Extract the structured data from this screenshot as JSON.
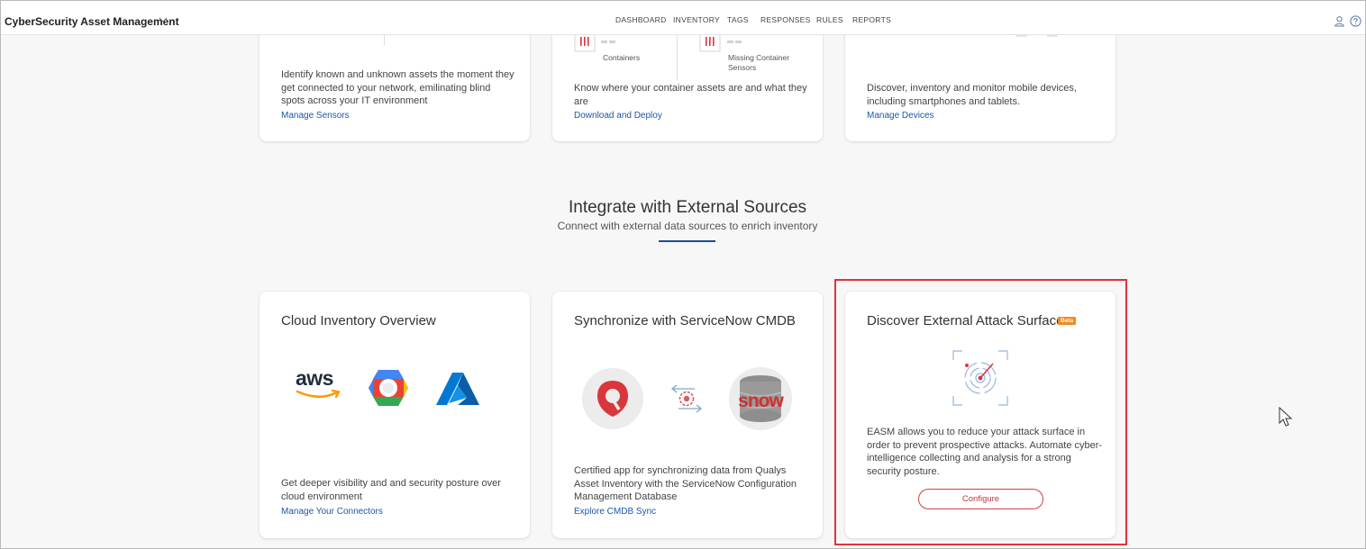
{
  "header": {
    "app_title": "CyberSecurity Asset Management",
    "nav": [
      "DASHBOARD",
      "INVENTORY",
      "TAGS",
      "RESPONSES",
      "RULES",
      "REPORTS"
    ],
    "icons": [
      "user-icon",
      "help-icon"
    ]
  },
  "top_cards": [
    {
      "text": "Identify known and unknown assets the moment they get connected to your network, emilinating blind spots across your IT environment",
      "link": "Manage Sensors"
    },
    {
      "labels": [
        "Containers",
        "Missing Container Sensors"
      ],
      "text": "Know where your container assets are and what they are",
      "link": "Download and Deploy"
    },
    {
      "text": "Discover, inventory and monitor mobile devices, including smartphones and tablets.",
      "link": "Manage Devices"
    }
  ],
  "section": {
    "title": "Integrate with External Sources",
    "subtitle": "Connect with external data sources to enrich inventory",
    "accent_color": "#1d4e89"
  },
  "cards": [
    {
      "title": "Cloud Inventory Overview",
      "logos": [
        "aws-logo",
        "google-cloud-logo",
        "azure-logo"
      ],
      "aws_text": "aws",
      "text": "Get deeper visibility and and security posture over cloud environment",
      "link": "Manage Your Connectors"
    },
    {
      "title": "Synchronize with ServiceNow CMDB",
      "logos": [
        "qualys-logo",
        "sync-icon",
        "servicenow-logo"
      ],
      "snow_text": "snow",
      "text": "Certified app for synchronizing data from Qualys Asset Inventory with the ServiceNow Configuration Management Database",
      "link": "Explore CMDB Sync"
    },
    {
      "title": "Discover External Attack Surface",
      "badge": "Beta",
      "icon": "radar-icon",
      "text": "EASM allows you to reduce your attack surface in order to prevent prospective attacks. Automate cyber-intelligence collecting and analysis for a strong security posture.",
      "button": "Configure",
      "highlight_color": "#e0343a"
    }
  ]
}
